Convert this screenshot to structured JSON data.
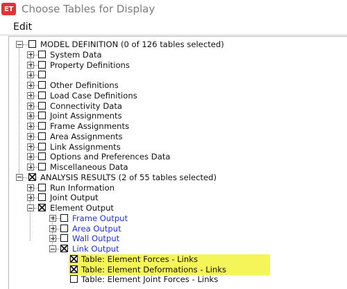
{
  "window": {
    "app_badge": "ET",
    "title": "Choose Tables for Display"
  },
  "menu": {
    "edit": "Edit"
  },
  "tree": {
    "model_definition": {
      "label": "MODEL DEFINITION  (0 of 126 tables selected)",
      "children": [
        "System Data",
        "Property Definitions",
        "",
        "Other Definitions",
        "Load Case Definitions",
        "Connectivity Data",
        "Joint Assignments",
        "Frame Assignments",
        "Area Assignments",
        "Link Assignments",
        "Options and Preferences Data",
        "Miscellaneous Data"
      ]
    },
    "analysis_results": {
      "label": "ANALYSIS RESULTS  (2 of 55 tables selected)",
      "run_information": "Run Information",
      "joint_output": "Joint Output",
      "element_output": {
        "label": "Element Output",
        "frame_output": "Frame Output",
        "area_output": "Area Output",
        "wall_output": "Wall Output",
        "link_output": {
          "label": "Link Output",
          "tables": [
            {
              "label": "Table:  Element Forces - Links",
              "checked": true,
              "highlighted": true
            },
            {
              "label": "Table:  Element Deformations - Links",
              "checked": true,
              "highlighted": true
            },
            {
              "label": "Table:  Element Joint Forces - Links",
              "checked": false,
              "highlighted": false
            }
          ]
        }
      }
    }
  },
  "colors": {
    "highlight": "#f5f55a",
    "link_blue": "#2233cc",
    "badge_red": "#e03434"
  }
}
